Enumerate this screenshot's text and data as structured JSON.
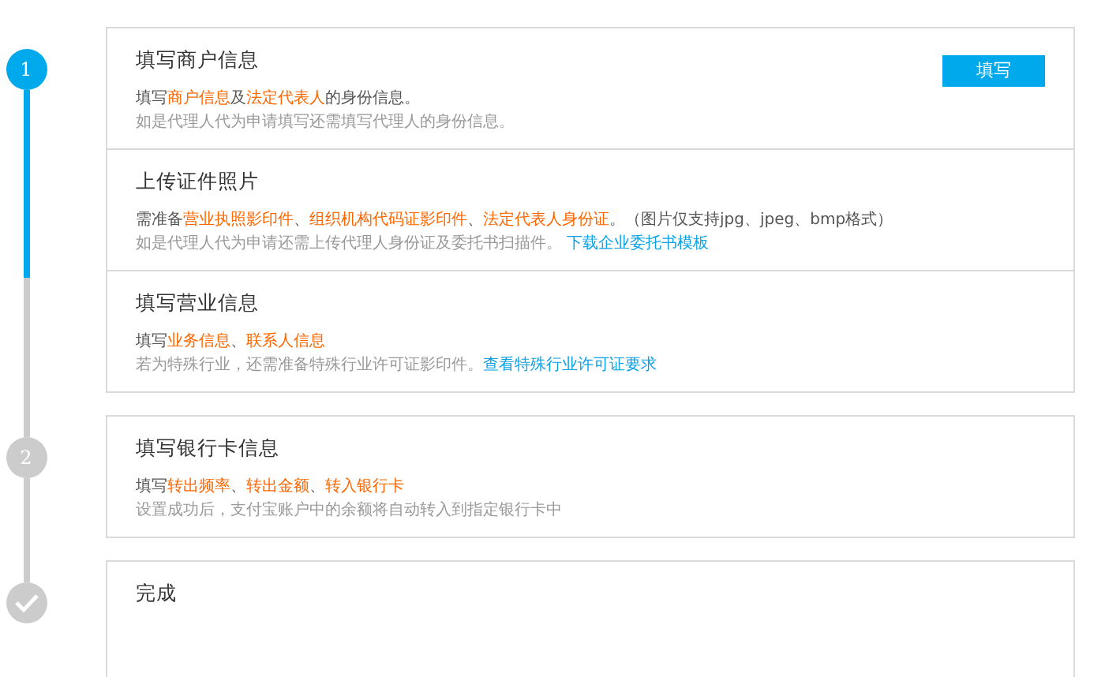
{
  "steps": [
    {
      "marker": {
        "kind": "number",
        "label": "1",
        "active": true
      },
      "progress": {
        "level": 0.58
      },
      "sections": [
        {
          "title": "填写商户信息",
          "button": "填写",
          "lines": [
            {
              "kind": "main",
              "parts": [
                {
                  "kind": "plain",
                  "text": "填写"
                },
                {
                  "kind": "highlight",
                  "text": "商户信息"
                },
                {
                  "kind": "plain",
                  "text": "及"
                },
                {
                  "kind": "highlight",
                  "text": "法定代表人"
                },
                {
                  "kind": "plain",
                  "text": "的身份信息。"
                }
              ]
            },
            {
              "kind": "note",
              "parts": [
                {
                  "kind": "plain",
                  "text": "如是代理人代为申请填写还需填写代理人的身份信息。"
                }
              ]
            }
          ]
        },
        {
          "title": "上传证件照片",
          "lines": [
            {
              "kind": "main",
              "parts": [
                {
                  "kind": "plain",
                  "text": "需准备"
                },
                {
                  "kind": "highlight",
                  "text": "营业执照影印件"
                },
                {
                  "kind": "plain",
                  "text": "、"
                },
                {
                  "kind": "highlight",
                  "text": "组织机构代码证影印件"
                },
                {
                  "kind": "plain",
                  "text": "、"
                },
                {
                  "kind": "highlight",
                  "text": "法定代表人身份证"
                },
                {
                  "kind": "plain",
                  "text": "。（图片仅支持jpg、jpeg、bmp格式）"
                }
              ]
            },
            {
              "kind": "note",
              "parts": [
                {
                  "kind": "plain",
                  "text": "如是代理人代为申请还需上传代理人身份证及委托书扫描件。 "
                },
                {
                  "kind": "link",
                  "text": "下载企业委托书模板"
                }
              ]
            }
          ]
        },
        {
          "title": "填写营业信息",
          "lines": [
            {
              "kind": "main",
              "parts": [
                {
                  "kind": "plain",
                  "text": "填写"
                },
                {
                  "kind": "highlight",
                  "text": "业务信息"
                },
                {
                  "kind": "plain",
                  "text": "、"
                },
                {
                  "kind": "highlight",
                  "text": "联系人信息"
                }
              ]
            },
            {
              "kind": "note",
              "parts": [
                {
                  "kind": "plain",
                  "text": "若为特殊行业，还需准备特殊行业许可证影印件。"
                },
                {
                  "kind": "link",
                  "text": "查看特殊行业许可证要求"
                }
              ]
            }
          ]
        }
      ]
    },
    {
      "marker": {
        "kind": "number",
        "label": "2",
        "active": false
      },
      "sections": [
        {
          "title": "填写银行卡信息",
          "lines": [
            {
              "kind": "main",
              "parts": [
                {
                  "kind": "plain",
                  "text": "填写"
                },
                {
                  "kind": "highlight",
                  "text": "转出频率"
                },
                {
                  "kind": "plain",
                  "text": "、"
                },
                {
                  "kind": "highlight",
                  "text": "转出金额"
                },
                {
                  "kind": "plain",
                  "text": "、"
                },
                {
                  "kind": "highlight",
                  "text": "转入银行卡"
                }
              ]
            },
            {
              "kind": "note",
              "parts": [
                {
                  "kind": "plain",
                  "text": "设置成功后，支付宝账户中的余额将自动转入到指定银行卡中"
                }
              ]
            }
          ]
        }
      ]
    },
    {
      "marker": {
        "kind": "check",
        "active": false
      },
      "sections": [
        {
          "title": "完成"
        }
      ]
    }
  ]
}
